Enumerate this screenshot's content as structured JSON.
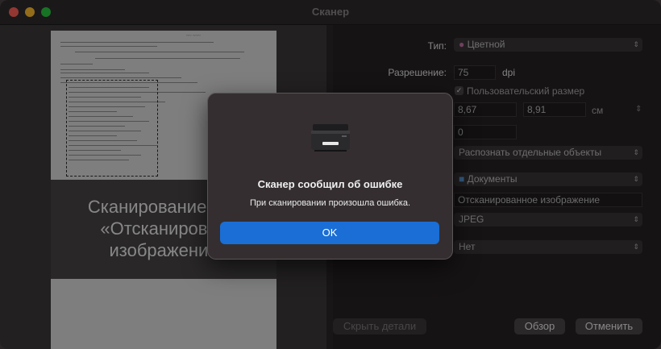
{
  "window": {
    "title": "Сканер"
  },
  "preview": {
    "scanning_text": "Сканирование док\n«Отсканирован\nизображение"
  },
  "settings": {
    "type_label": "Тип:",
    "type_value": "Цветной",
    "resolution_label": "Разрешение:",
    "resolution_value": "75",
    "resolution_unit": "dpi",
    "custom_size_label": "Пользовательский размер",
    "width_value": "8,67",
    "height_value": "8,91",
    "size_unit": "см",
    "rotation_value": "0",
    "detect_value": "Распознать отдельные объекты",
    "folder_value": "Документы",
    "name_value": "Отсканированное изображение",
    "format_value": "JPEG",
    "correction_value": "Нет"
  },
  "buttons": {
    "hide_details": "Скрыть детали",
    "overview": "Обзор",
    "cancel": "Отменить"
  },
  "alert": {
    "title": "Сканер сообщил об ошибке",
    "message": "При сканировании произошла ошибка.",
    "ok_label": "OK"
  },
  "colors": {
    "accent": "#1a6ed6",
    "close": "#fe5f57",
    "minimize": "#febc2e",
    "maximize": "#28c840"
  },
  "icons": {
    "printer": "printer-icon",
    "folder": "folder-icon",
    "color": "color-icon"
  }
}
